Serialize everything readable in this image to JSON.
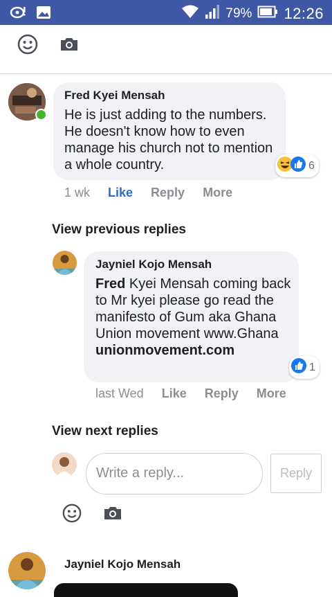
{
  "status_bar": {
    "battery": "79%",
    "time": "12:26"
  },
  "comment": {
    "author": "Fred Kyei Mensah",
    "text": "He is just adding to the numbers. He doesn't know how to even manage his church not to mention a whole country.",
    "reaction_count": "6",
    "time": "1 wk",
    "like_label": "Like",
    "reply_label": "Reply",
    "more_label": "More"
  },
  "view_previous_label": "View previous replies",
  "reply1": {
    "author": "Jayniel Kojo Mensah",
    "mention": "Fred",
    "text": " Kyei Mensah coming back to Mr kyei please go read the manifesto of Gum aka Ghana Union movement www.Ghana",
    "link": "unionmovement.com",
    "reaction_count": "1",
    "time": "last Wed",
    "like_label": "Like",
    "reply_label": "Reply",
    "more_label": "More"
  },
  "view_next_label": "View next replies",
  "composer": {
    "placeholder": "Write a reply...",
    "button_label": "Reply"
  },
  "next_comment": {
    "author": "Jayniel Kojo Mensah"
  },
  "colors": {
    "status_bar": "#3f58a6",
    "link_blue": "#2d6ccc",
    "online_green": "#42b72a",
    "bubble": "#f0f2f5"
  }
}
